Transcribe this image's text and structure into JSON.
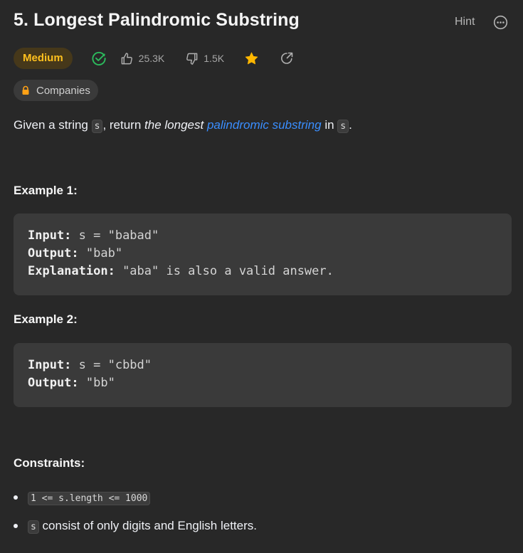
{
  "problem": {
    "title": "5. Longest Palindromic Substring",
    "hint_label": "Hint",
    "difficulty": "Medium",
    "likes": "25.3K",
    "dislikes": "1.5K",
    "companies_label": "Companies"
  },
  "description": {
    "part1": "Given a string ",
    "code1": "s",
    "part2": ", return ",
    "em": "the longest",
    "space": " ",
    "link": "palindromic substring",
    "part3": " in ",
    "code2": "s",
    "part4": "."
  },
  "examples": [
    {
      "title": "Example 1:",
      "input_label": "Input:",
      "input_value": " s = \"babad\"",
      "output_label": "Output:",
      "output_value": " \"bab\"",
      "explanation_label": "Explanation:",
      "explanation_value": " \"aba\" is also a valid answer."
    },
    {
      "title": "Example 2:",
      "input_label": "Input:",
      "input_value": " s = \"cbbd\"",
      "output_label": "Output:",
      "output_value": " \"bb\""
    }
  ],
  "constraints": {
    "title": "Constraints:",
    "items": [
      {
        "code": "1 <= s.length <= 1000",
        "text": ""
      },
      {
        "code": "s",
        "text": " consist of only digits and English letters."
      }
    ]
  },
  "colors": {
    "background": "#282828",
    "medium": "#ffc01e",
    "solved": "#2cbb5d",
    "star": "#ffb700",
    "link": "#3a8eff"
  },
  "icons": [
    "ellipsis-icon",
    "check-circle-icon",
    "thumbs-up-icon",
    "thumbs-down-icon",
    "star-icon",
    "share-icon",
    "lock-icon"
  ]
}
